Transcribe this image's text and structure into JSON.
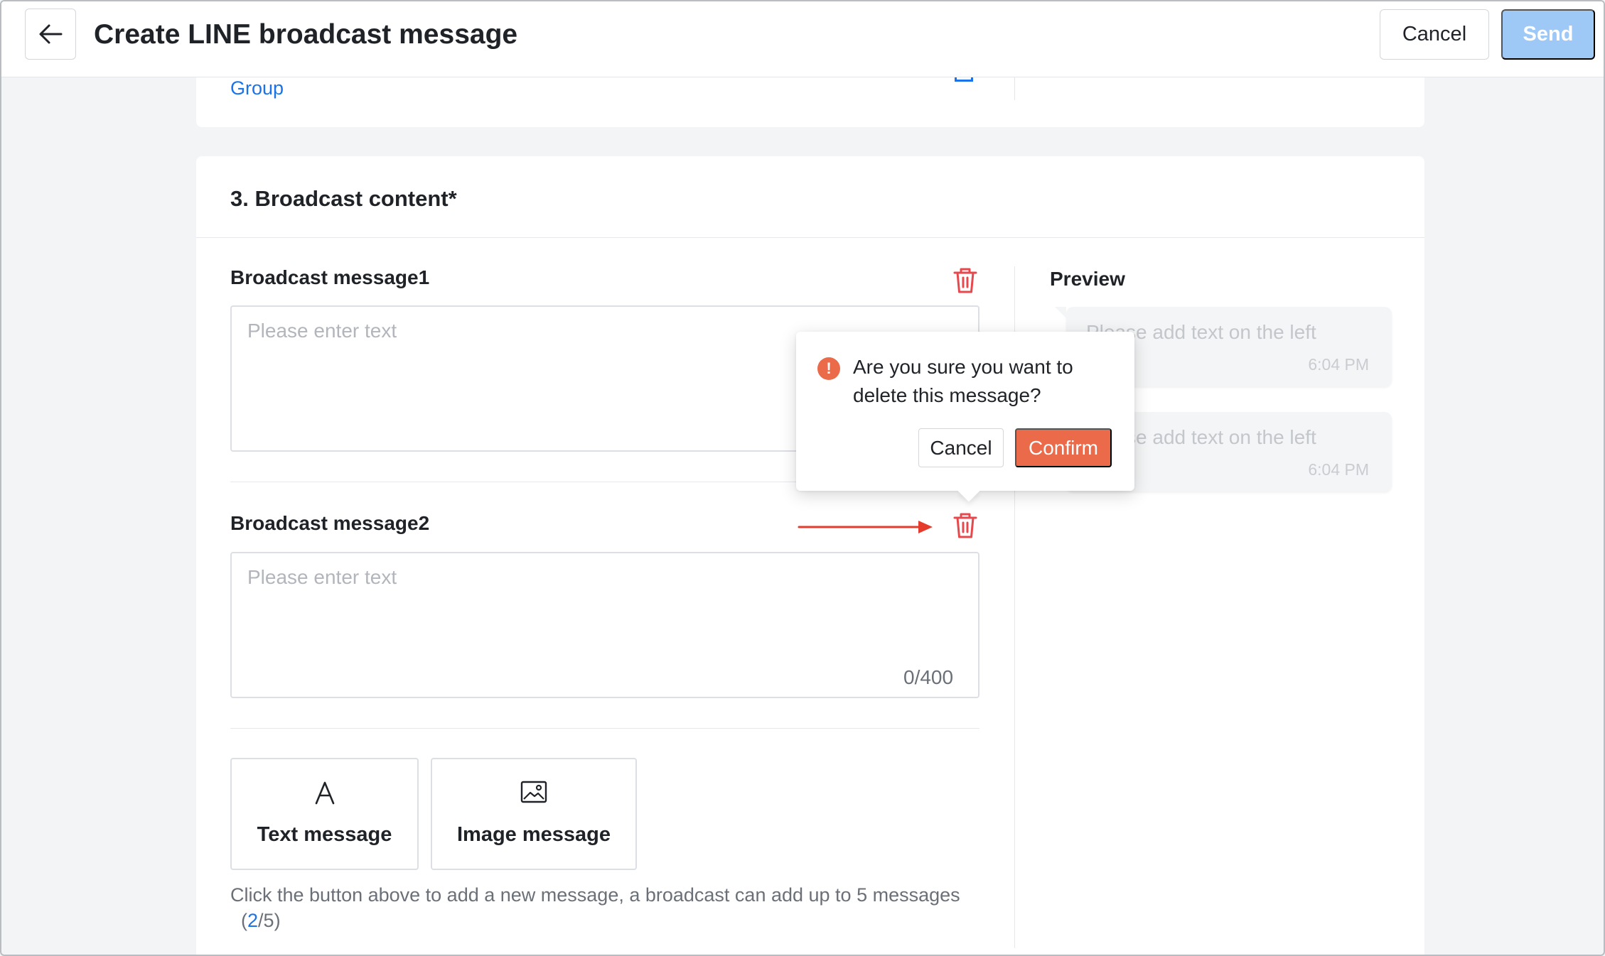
{
  "header": {
    "title": "Create LINE broadcast message",
    "cancel_label": "Cancel",
    "send_label": "Send"
  },
  "top_card": {
    "group_link": "Group"
  },
  "section": {
    "title": "3. Broadcast content*"
  },
  "messages": [
    {
      "label": "Broadcast message1",
      "placeholder": "Please enter text",
      "counter": ""
    },
    {
      "label": "Broadcast message2",
      "placeholder": "Please enter text",
      "counter": "0/400"
    }
  ],
  "add_buttons": {
    "text_message": "Text message",
    "image_message": "Image message"
  },
  "hint": {
    "text": "Click the button above to add a new message, a broadcast can add up to 5 messages",
    "count_open": "(",
    "count_current": "2",
    "count_rest": "/5)"
  },
  "preview": {
    "title": "Preview",
    "bubbles": [
      {
        "text": "Please add text on the left",
        "time": "6:04 PM"
      },
      {
        "text": "Please add text on the left",
        "time": "6:04 PM"
      }
    ]
  },
  "popconfirm": {
    "icon": "!",
    "message": "Are you sure you want to delete this message?",
    "cancel_label": "Cancel",
    "confirm_label": "Confirm"
  },
  "colors": {
    "primary": "#1a73e8",
    "danger": "#ea6a4a",
    "send_disabled": "#9ec9f7",
    "annotation_arrow": "#e53b2c"
  }
}
